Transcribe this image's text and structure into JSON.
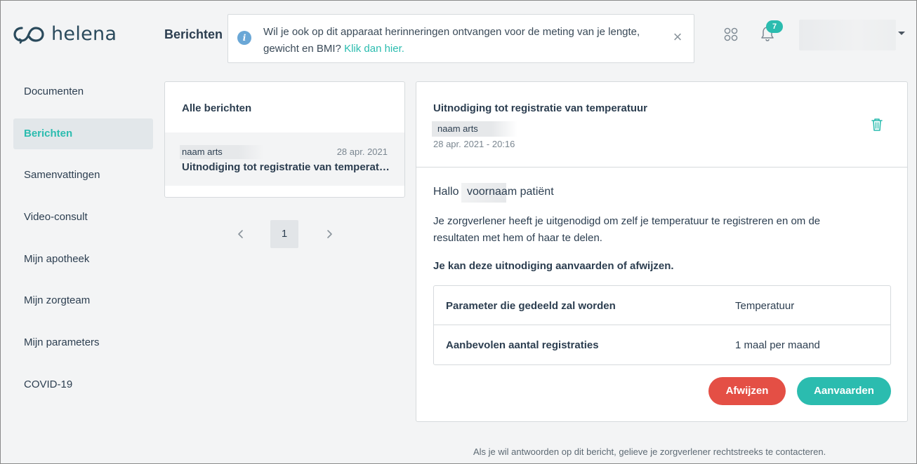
{
  "brand": {
    "logo_text": "helena",
    "logo_icon": "infinity-logo-icon",
    "accent_color": "#2bbcaf",
    "danger_color": "#e44f45"
  },
  "header": {
    "page_title": "Berichten",
    "banner": {
      "text": "Wil je ook op dit apparaat herinneringen ontvangen voor de meting van je lengte, gewicht en BMI?",
      "link": "Klik dan hier.",
      "close": "×"
    },
    "notifications_count": "7"
  },
  "sidebar": {
    "items": [
      {
        "label": "Documenten"
      },
      {
        "label": "Berichten",
        "active": true
      },
      {
        "label": "Samenvattingen"
      },
      {
        "label": "Video-consult"
      },
      {
        "label": "Mijn apotheek"
      },
      {
        "label": "Mijn zorgteam"
      },
      {
        "label": "Mijn parameters"
      },
      {
        "label": "COVID-19"
      }
    ]
  },
  "message_list": {
    "title": "Alle berichten",
    "items": [
      {
        "sender": "naam arts",
        "date": "28 apr. 2021",
        "subject": "Uitnodiging tot registratie van temperatuur"
      }
    ],
    "pagination": {
      "current_page": "1"
    }
  },
  "message": {
    "title": "Uitnodiging tot registratie van temperatuur",
    "sender": "naam arts",
    "datetime": "28 apr. 2021 - 20:16",
    "greeting": "Hallo",
    "patient": "voornaam patiënt",
    "body": "Je zorgverlener heeft je uitgenodigd om zelf je temperatuur te registreren en om de resultaten met hem of haar te delen.",
    "body_strong": "Je kan deze uitnodiging aanvaarden of afwijzen.",
    "params": [
      {
        "label": "Parameter die gedeeld zal worden",
        "value": "Temperatuur"
      },
      {
        "label": "Aanbevolen aantal registraties",
        "value": "1 maal per maand"
      }
    ],
    "reject_label": "Afwijzen",
    "accept_label": "Aanvaarden"
  },
  "footer": {
    "note": "Als je wil antwoorden op dit bericht, gelieve je zorgverlener rechtstreeks te contacteren."
  }
}
